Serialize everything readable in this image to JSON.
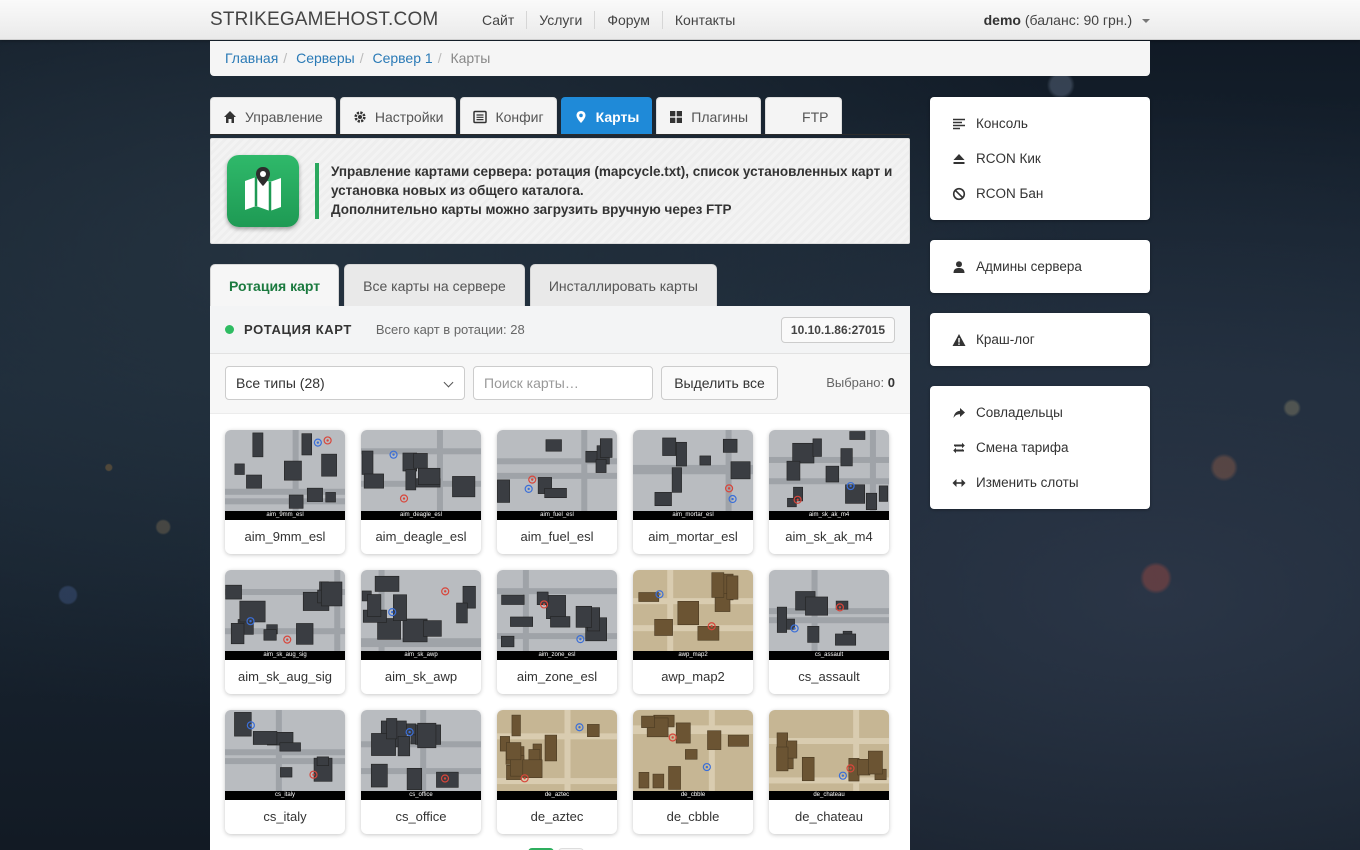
{
  "navbar": {
    "brand": "STRIKEGAMEHOST.COM",
    "links": [
      "Сайт",
      "Услуги",
      "Форум",
      "Контакты"
    ],
    "user_name": "demo",
    "user_balance": "(баланс: 90 грн.)"
  },
  "breadcrumb": [
    "Главная",
    "Серверы",
    "Сервер 1",
    "Карты"
  ],
  "main_tabs": [
    {
      "label": "Управление",
      "icon": "home-icon"
    },
    {
      "label": "Настройки",
      "icon": "gear-icon"
    },
    {
      "label": "Конфиг",
      "icon": "list-icon"
    },
    {
      "label": "Карты",
      "icon": "map-pin-icon",
      "active": true
    },
    {
      "label": "Плагины",
      "icon": "grid-icon"
    },
    {
      "label": "FTP",
      "icon": ""
    }
  ],
  "info": {
    "line1": "Управление картами сервера: ротация (mapcycle.txt), список установленных карт и установка новых из общего каталога.",
    "line2": "Дополнительно карты можно загрузить вручную через FTP"
  },
  "sub_tabs": [
    "Ротация карт",
    "Все карты на сервере",
    "Инсталлировать карты"
  ],
  "panel": {
    "title": "РОТАЦИЯ КАРТ",
    "count": "Всего карт в ротации: 28",
    "ip": "10.10.1.86:27015"
  },
  "filters": {
    "type_select": "Все типы (28)",
    "search_placeholder": "Поиск карты…",
    "select_all": "Выделить все",
    "selected_label": "Выбрано:",
    "selected_count": "0"
  },
  "maps": [
    {
      "name": "aim_9mm_esl",
      "theme": "gray"
    },
    {
      "name": "aim_deagle_esl",
      "theme": "gray"
    },
    {
      "name": "aim_fuel_esl",
      "theme": "gray"
    },
    {
      "name": "aim_mortar_esl",
      "theme": "gray"
    },
    {
      "name": "aim_sk_ak_m4",
      "theme": "gray"
    },
    {
      "name": "aim_sk_aug_sig",
      "theme": "gray"
    },
    {
      "name": "aim_sk_awp",
      "theme": "gray"
    },
    {
      "name": "aim_zone_esl",
      "theme": "gray"
    },
    {
      "name": "awp_map2",
      "theme": "tan"
    },
    {
      "name": "cs_assault",
      "theme": "gray"
    },
    {
      "name": "cs_italy",
      "theme": "gray"
    },
    {
      "name": "cs_office",
      "theme": "gray"
    },
    {
      "name": "de_aztec",
      "theme": "tan"
    },
    {
      "name": "de_cbble",
      "theme": "tan"
    },
    {
      "name": "de_chateau",
      "theme": "tan"
    }
  ],
  "sidebar": {
    "group1": [
      {
        "label": "Консоль",
        "icon": "console-icon"
      },
      {
        "label": "RCON Кик",
        "icon": "eject-icon"
      },
      {
        "label": "RCON Бан",
        "icon": "ban-icon"
      }
    ],
    "group2": [
      {
        "label": "Админы сервера",
        "icon": "user-icon"
      }
    ],
    "group3": [
      {
        "label": "Краш-лог",
        "icon": "warning-icon"
      }
    ],
    "group4": [
      {
        "label": "Совладельцы",
        "icon": "share-icon"
      },
      {
        "label": "Смена тарифа",
        "icon": "retweet-icon"
      },
      {
        "label": "Изменить слоты",
        "icon": "resize-icon"
      }
    ]
  },
  "colors": {
    "accent": "#1f8ad8",
    "green": "#2aa85e",
    "link": "#2a7ab6"
  }
}
